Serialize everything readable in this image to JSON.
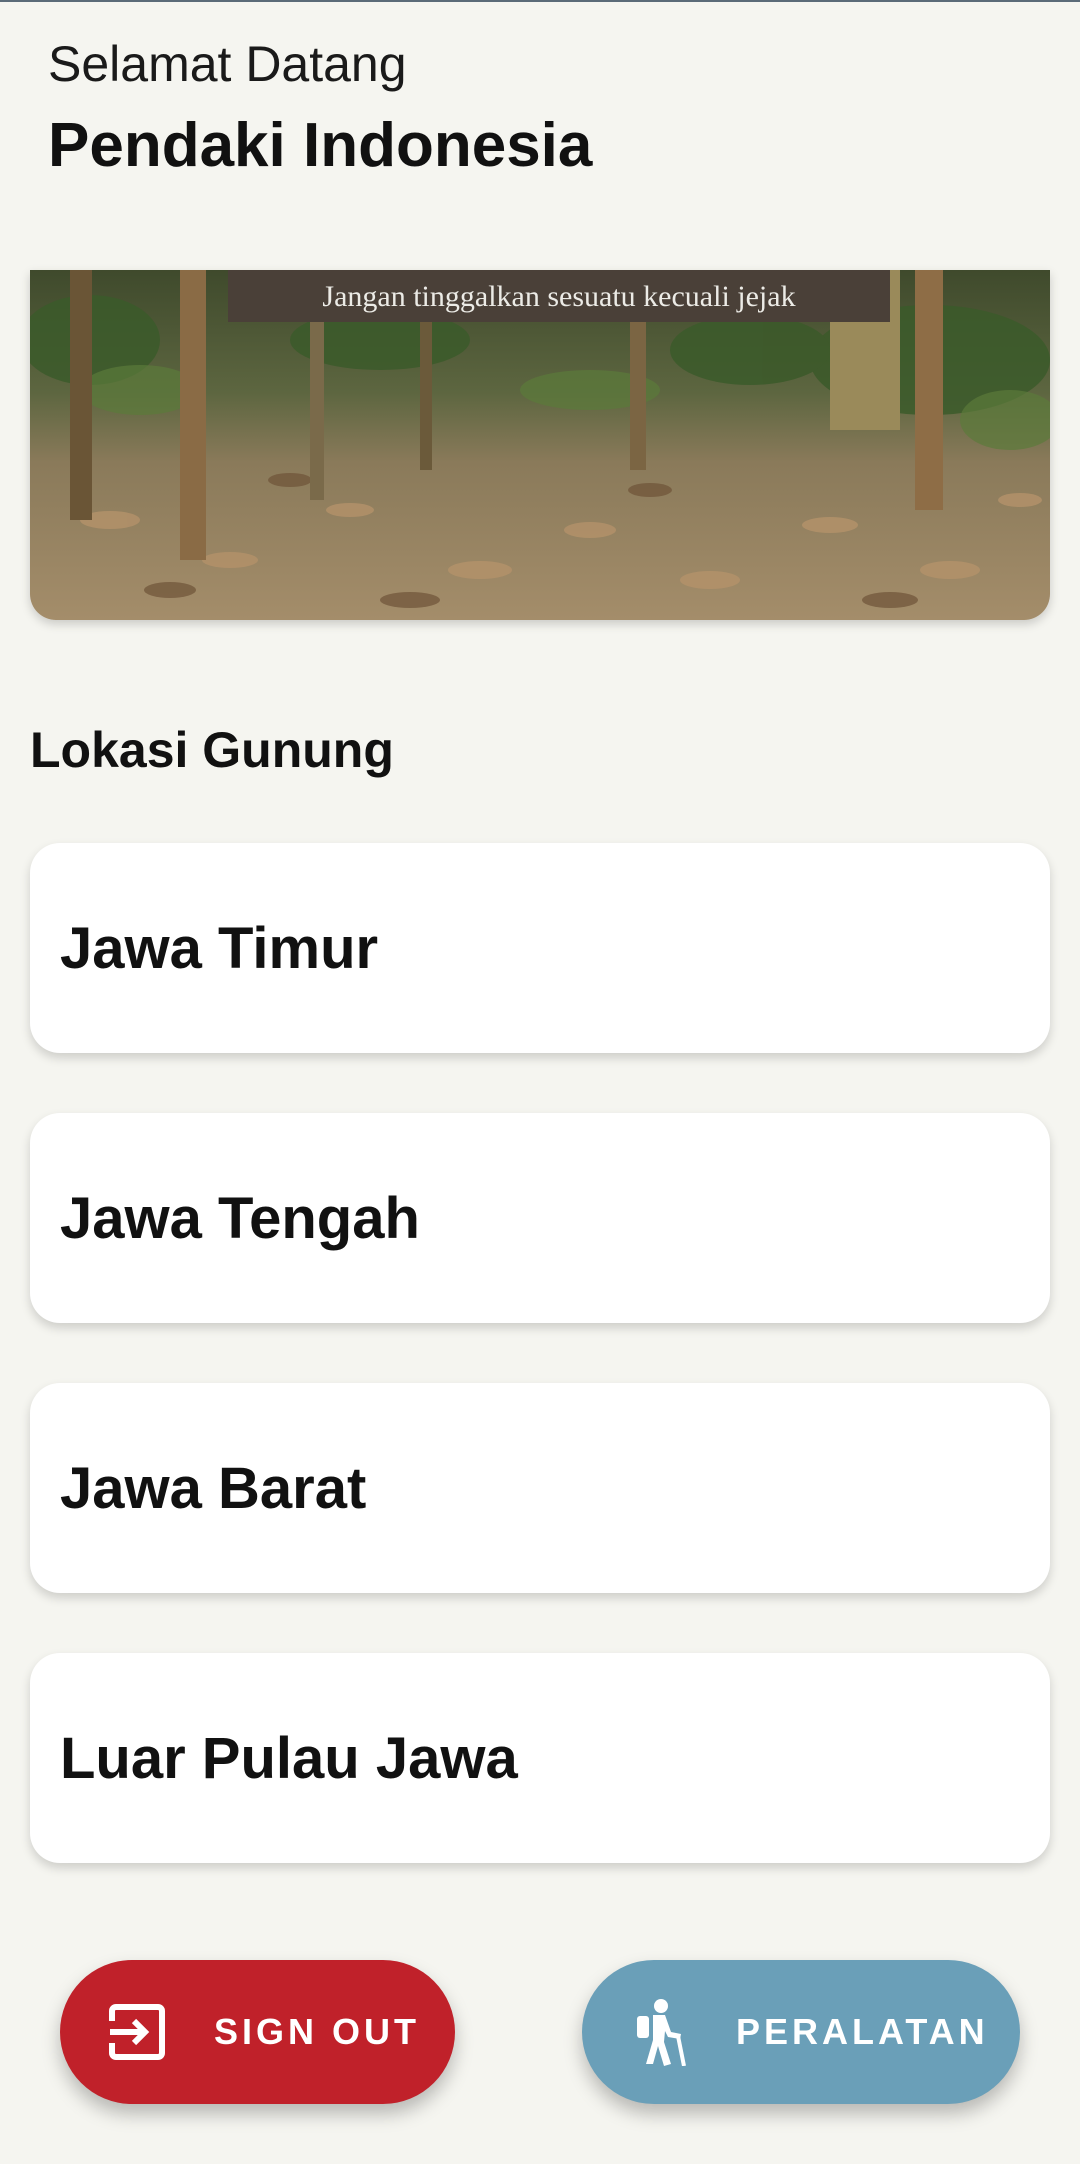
{
  "header": {
    "greeting": "Selamat Datang",
    "title": "Pendaki Indonesia"
  },
  "banner": {
    "sign_text": "Jangan tinggalkan sesuatu kecuali jejak"
  },
  "section": {
    "title": "Lokasi Gunung"
  },
  "locations": [
    {
      "label": "Jawa Timur"
    },
    {
      "label": "Jawa Tengah"
    },
    {
      "label": "Jawa Barat"
    },
    {
      "label": "Luar Pulau Jawa"
    }
  ],
  "actions": {
    "sign_out": {
      "label": "SIGN OUT",
      "icon": "exit-icon",
      "color": "#c0212a"
    },
    "peralatan": {
      "label": "PERALATAN",
      "icon": "hiker-icon",
      "color": "#6a9fb8"
    }
  },
  "colors": {
    "background": "#f5f5f0",
    "card": "#ffffff"
  }
}
